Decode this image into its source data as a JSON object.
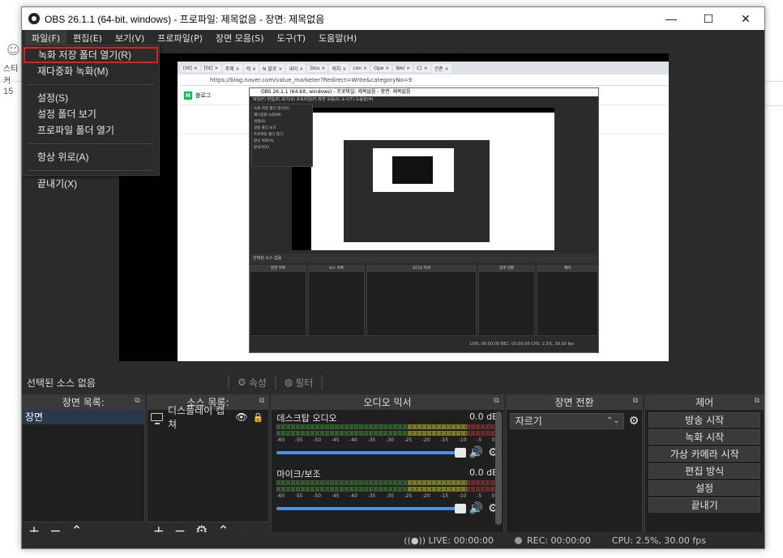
{
  "background": {
    "left_label": "스티커",
    "left_number": "15"
  },
  "window": {
    "title": "OBS 26.1.1 (64-bit, windows) - 프로파일: 제목없음 - 장면: 제목없음",
    "controls": {
      "minimize": "—",
      "maximize": "☐",
      "close": "✕"
    }
  },
  "menu": [
    "파일(F)",
    "편집(E)",
    "보기(V)",
    "프로파일(P)",
    "장면 모음(S)",
    "도구(T)",
    "도움말(H)"
  ],
  "file_menu": {
    "items": [
      "녹화 저장 폴더 열기(R)",
      "재다중화 녹화(M)",
      "설정(S)",
      "설정 폴더 보기",
      "프로파일 폴더 열기",
      "항상 위로(A)",
      "끝내기(X)"
    ],
    "highlighted_index": 0
  },
  "preview": {
    "browser_tabs": [
      "[ht] ×",
      "[ht] ×",
      "주제 ×",
      "케 ×",
      "N 블로 ×",
      "내이 ×",
      "Dou ×",
      "캐치 ×",
      "con ×",
      "Ope ×",
      "Wel ×",
      "C( ×",
      "건준 ×"
    ],
    "url": "https://blog.naver.com/value_marketer?Redirect=Write&categoryNo=9",
    "blog_label": "블로그",
    "nested_title": "OBS 26.1.1 (64-bit, windows) - 프로파일: 제목없음 - 장면: 제목없음",
    "nested_menu": "파일(F)  편집(E)  보기(V)  프로파일(P)  장면 모음(S)  도구(T)  도움말(H)",
    "nested_dropdown": [
      "녹화 저장 폴더 열기(R)",
      "재다중화 녹화(M)",
      "설정(S)",
      "설정 폴더 보기",
      "프로파일 폴더 열기",
      "항상 위로(A)",
      "끝내기(X)"
    ],
    "nested_selected": "선택된 소스 없음",
    "nested_docks": [
      "장면 목록",
      "소스 목록",
      "오디오 믹서",
      "장면 전환",
      "제어"
    ],
    "nested_status": "LIVE: 00:00:00   REC: 00:00:00   CPU: 2.5%, 30.00 fps"
  },
  "source_bar": {
    "none_label": "선택된 소스 없음",
    "properties_label": "속성",
    "filters_label": "필터"
  },
  "docks": {
    "scenes": {
      "header": "장면 목록:",
      "items": [
        "장면"
      ]
    },
    "sources": {
      "header": "소스 목록:",
      "items": [
        {
          "name": "디스플레이 캡쳐"
        }
      ]
    },
    "mixer": {
      "header": "오디오 믹서",
      "channels": [
        {
          "name": "데스크탑 오디오",
          "db": "0.0 dB"
        },
        {
          "name": "마이크/보조",
          "db": "0.0 dB"
        }
      ],
      "ticks": [
        "-60",
        "-55",
        "-50",
        "-45",
        "-40",
        "-35",
        "-30",
        "-25",
        "-20",
        "-15",
        "-10",
        "-5",
        "0"
      ]
    },
    "transitions": {
      "header": "장면 전환",
      "selected": "자르기"
    },
    "controls": {
      "header": "제어",
      "buttons": [
        "방송 시작",
        "녹화 시작",
        "가상 카메라 시작",
        "편집 방식",
        "설정",
        "끝내기"
      ]
    }
  },
  "status": {
    "live": "LIVE: 00:00:00",
    "rec": "REC: 00:00:00",
    "cpu": "CPU: 2.5%, 30.00 fps"
  },
  "colors": {
    "obs_bg": "#2b2b2b",
    "dock_body": "#1f1f1f",
    "highlight_border": "#e02020",
    "scene_selected": "#29384c",
    "volume_slider": "#4a90e2"
  }
}
